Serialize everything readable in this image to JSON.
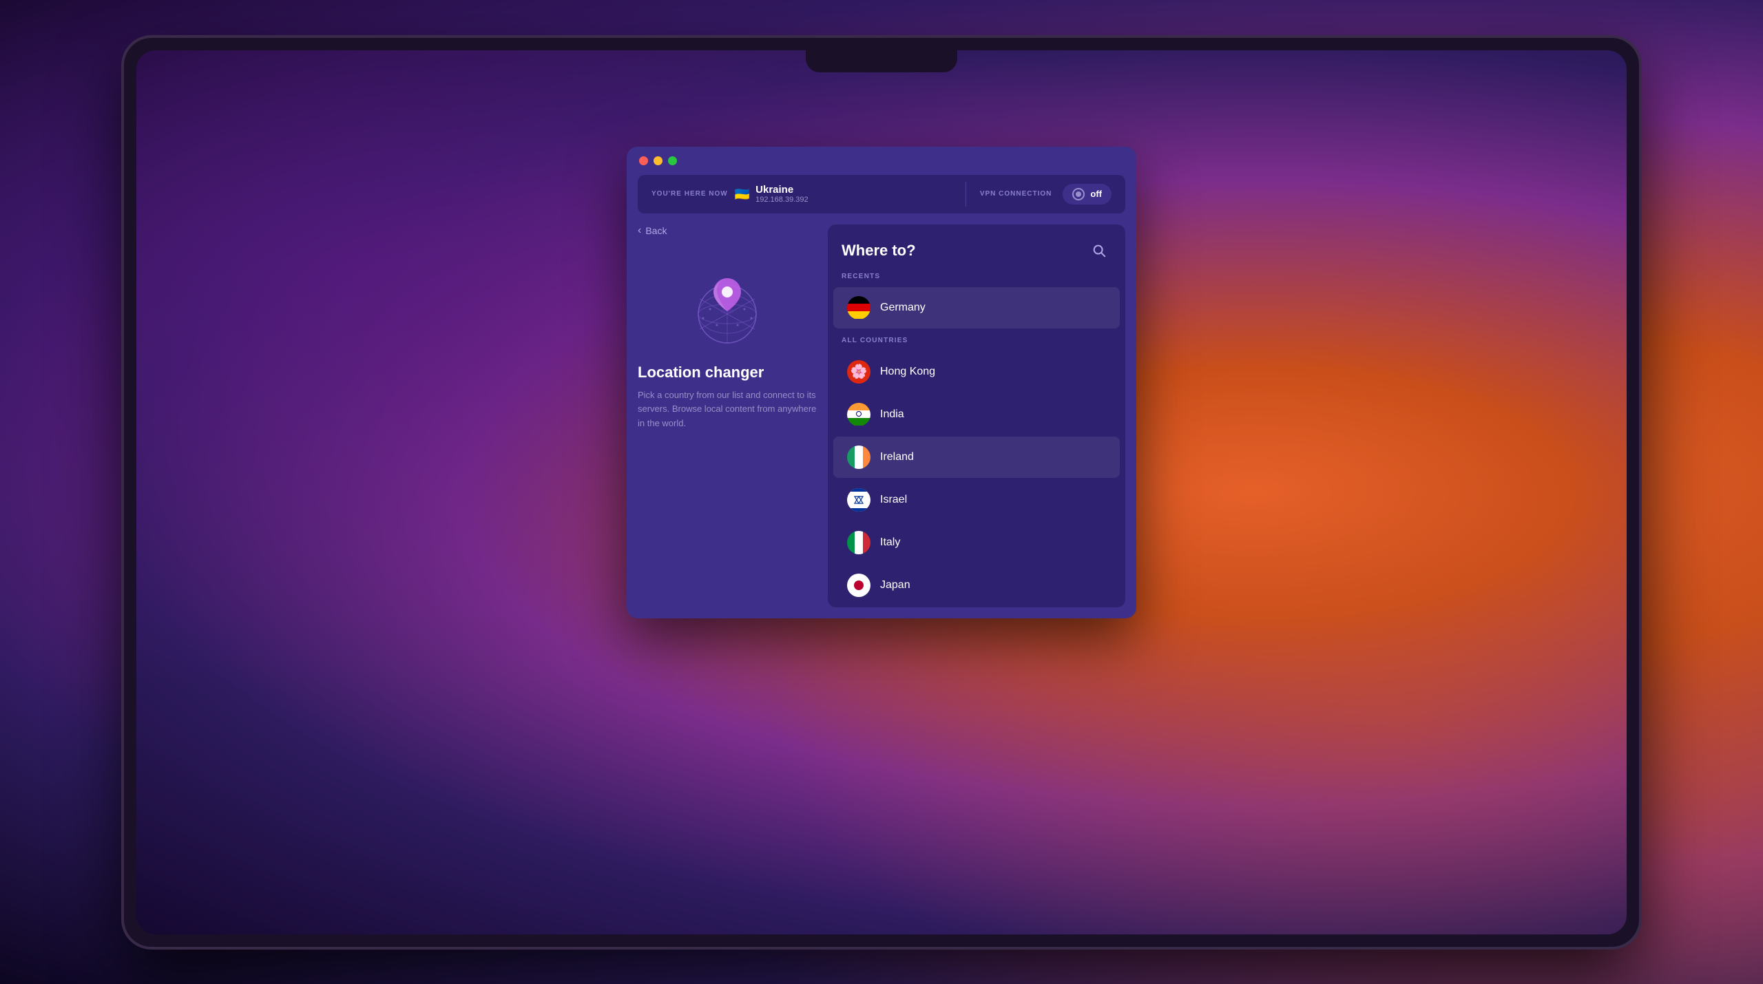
{
  "desktop": {
    "bg_color": "#1a0a2e"
  },
  "window": {
    "controls": {
      "close": "close",
      "minimize": "minimize",
      "maximize": "maximize"
    },
    "header": {
      "you_are_here_label": "YOU'RE HERE NOW",
      "current_country": "Ukraine",
      "current_flag": "🇺🇦",
      "current_ip": "192.168.39.392",
      "vpn_label": "VPN CONNECTION",
      "vpn_status": "off"
    },
    "left_panel": {
      "back_label": "Back",
      "title": "Location changer",
      "description": "Pick a country from our list and connect to its servers. Browse local content from anywhere in the world."
    },
    "right_panel": {
      "title": "Where to?",
      "recents_label": "RECENTS",
      "all_countries_label": "ALL COUNTRIES",
      "recents": [
        {
          "name": "Germany",
          "flag_type": "germany"
        }
      ],
      "countries": [
        {
          "name": "Hong Kong",
          "flag_type": "hk"
        },
        {
          "name": "India",
          "flag_type": "india"
        },
        {
          "name": "Ireland",
          "flag_type": "ireland"
        },
        {
          "name": "Israel",
          "flag_type": "israel"
        },
        {
          "name": "Italy",
          "flag_type": "italy"
        },
        {
          "name": "Japan",
          "flag_type": "japan"
        }
      ]
    }
  }
}
